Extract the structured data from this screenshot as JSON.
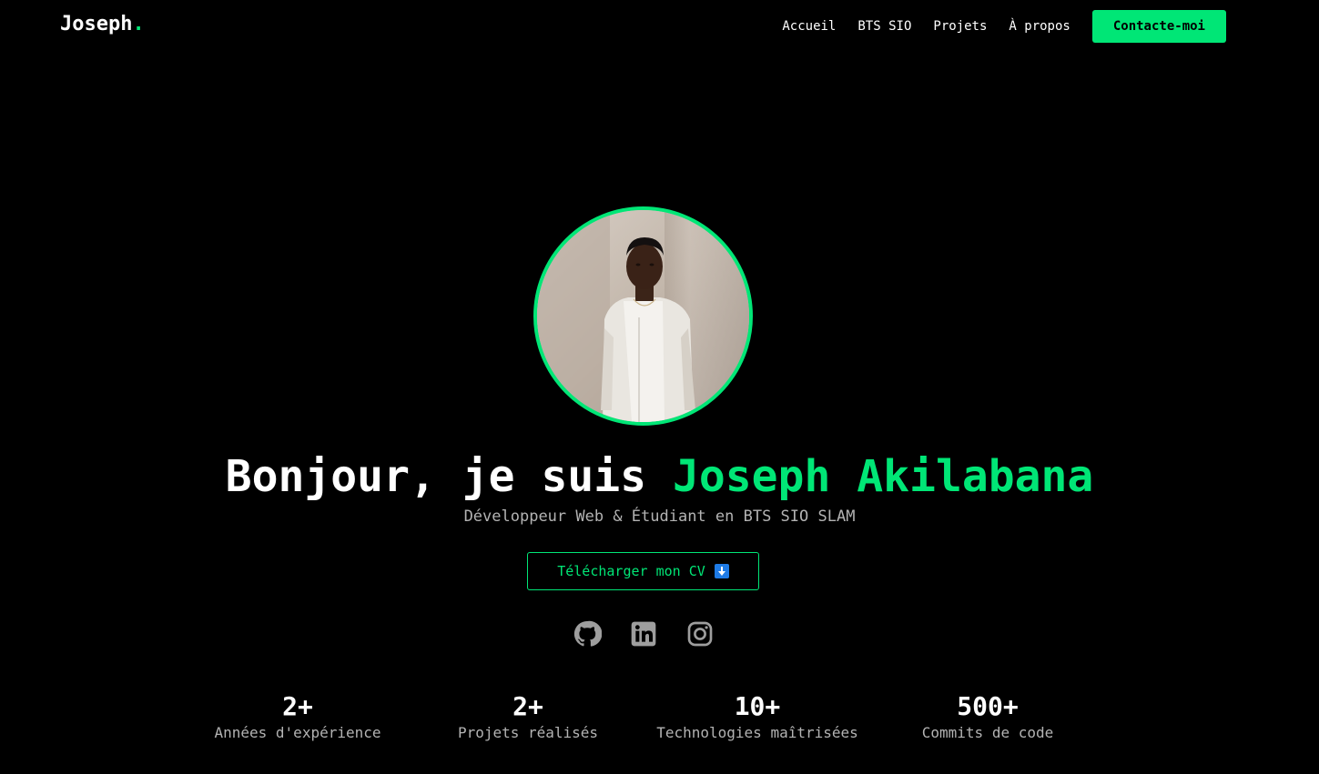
{
  "brand": {
    "name": "Joseph",
    "dot": "."
  },
  "nav": {
    "links": [
      "Accueil",
      "BTS SIO",
      "Projets",
      "À propos"
    ],
    "cta": "Contacte-moi"
  },
  "hero": {
    "greeting": "Bonjour, je suis",
    "name": "Joseph Akilabana",
    "subtitle": "Développeur Web & Étudiant en BTS SIO SLAM",
    "cv_button": "Télécharger mon CV"
  },
  "socials": [
    "github-icon",
    "linkedin-icon",
    "instagram-icon"
  ],
  "stats": [
    {
      "value": "2+",
      "label": "Années d'expérience"
    },
    {
      "value": "2+",
      "label": "Projets réalisés"
    },
    {
      "value": "10+",
      "label": "Technologies maîtrisées"
    },
    {
      "value": "500+",
      "label": "Commits de code"
    }
  ],
  "colors": {
    "background": "#000000",
    "accent": "#00e676",
    "muted_text": "#b3b3b3",
    "icon_gray": "#9e9e9e"
  }
}
